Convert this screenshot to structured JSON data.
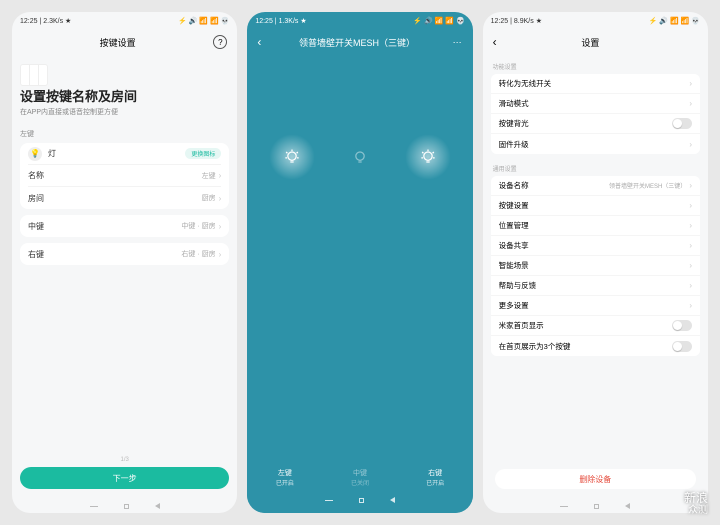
{
  "screen1": {
    "status": {
      "time": "12:25",
      "speed": "2.3K/s",
      "icons": "⚡ 🔊 📶 📶 💀"
    },
    "nav": {
      "title": "按键设置",
      "help": "?"
    },
    "header_title": "设置按键名称及房间",
    "header_sub": "在APP内直接或语音控制更方便",
    "left_label": "左键",
    "bulb_name": "灯",
    "pill": "更换图标",
    "name_label": "名称",
    "name_val": "左键",
    "room_label": "房间",
    "room_val": "厨房",
    "mid_label": "中键",
    "mid_val": "中键 · 厨房",
    "right_label": "右键",
    "right_val": "右键 · 厨房",
    "progress": "1/3",
    "next": "下一步"
  },
  "screen2": {
    "status": {
      "time": "12:25",
      "speed": "1.3K/s",
      "icons": "⚡ 🔊 📶 📶 💀"
    },
    "nav": {
      "title": "领普墙壁开关MESH（三键）"
    },
    "labels": [
      {
        "t": "左键",
        "s": "已开启",
        "dim": false
      },
      {
        "t": "中键",
        "s": "已关闭",
        "dim": true
      },
      {
        "t": "右键",
        "s": "已开启",
        "dim": false
      }
    ]
  },
  "screen3": {
    "status": {
      "time": "12:25",
      "speed": "8.9K/s",
      "icons": "⚡ 🔊 📶 📶 💀"
    },
    "nav": {
      "title": "设置"
    },
    "sec1_label": "功能设置",
    "items1": [
      {
        "t": "转化为无线开关",
        "chev": true
      },
      {
        "t": "滑动模式",
        "chev": true
      },
      {
        "t": "按键背光",
        "toggle": true
      },
      {
        "t": "固件升级",
        "chev": true
      }
    ],
    "sec2_label": "通用设置",
    "items2": [
      {
        "t": "设备名称",
        "v": "领普墙壁开关MESH（三键）",
        "chev": true
      },
      {
        "t": "按键设置",
        "chev": true
      },
      {
        "t": "位置管理",
        "chev": true
      },
      {
        "t": "设备共享",
        "chev": true
      },
      {
        "t": "智能场景",
        "chev": true
      },
      {
        "t": "帮助与反馈",
        "chev": true
      },
      {
        "t": "更多设置",
        "chev": true
      },
      {
        "t": "米家首页显示",
        "toggle": true
      },
      {
        "t": "在首页展示为3个按键",
        "toggle": true
      }
    ],
    "delete": "删除设备"
  },
  "watermark": {
    "brand": "新浪",
    "sub": "众测"
  }
}
